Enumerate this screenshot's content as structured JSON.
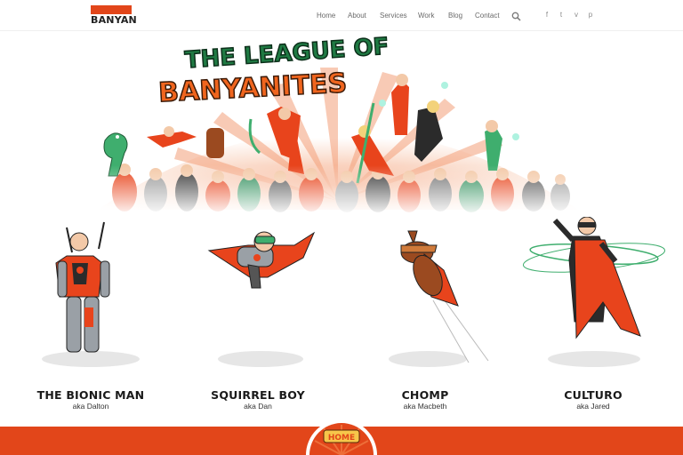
{
  "header": {
    "logo_text": "BANYAN",
    "nav": [
      {
        "label": "Home"
      },
      {
        "label": "About"
      },
      {
        "label": "Services"
      },
      {
        "label": "Work"
      },
      {
        "label": "Blog"
      },
      {
        "label": "Contact"
      }
    ],
    "search_icon": "search-icon",
    "social": [
      {
        "icon": "facebook-icon",
        "glyph": "f"
      },
      {
        "icon": "twitter-icon",
        "glyph": "t"
      },
      {
        "icon": "vimeo-icon",
        "glyph": "v"
      },
      {
        "icon": "pinterest-icon",
        "glyph": "p"
      }
    ]
  },
  "banner": {
    "title_line1": "THE LEAGUE OF",
    "title_line2": "BANYANITES"
  },
  "heroes": [
    {
      "name": "THE BIONIC MAN",
      "aka": "aka Dalton"
    },
    {
      "name": "SQUIRREL BOY",
      "aka": "aka Dan"
    },
    {
      "name": "CHOMP",
      "aka": "aka Macbeth"
    },
    {
      "name": "CULTURO",
      "aka": "aka Jared"
    }
  ],
  "footer": {
    "home_label": "HOME"
  },
  "colors": {
    "brand_orange": "#e2461a",
    "costume_red": "#e8441c",
    "title_green": "#1f7a43",
    "title_orange": "#f0651e"
  }
}
